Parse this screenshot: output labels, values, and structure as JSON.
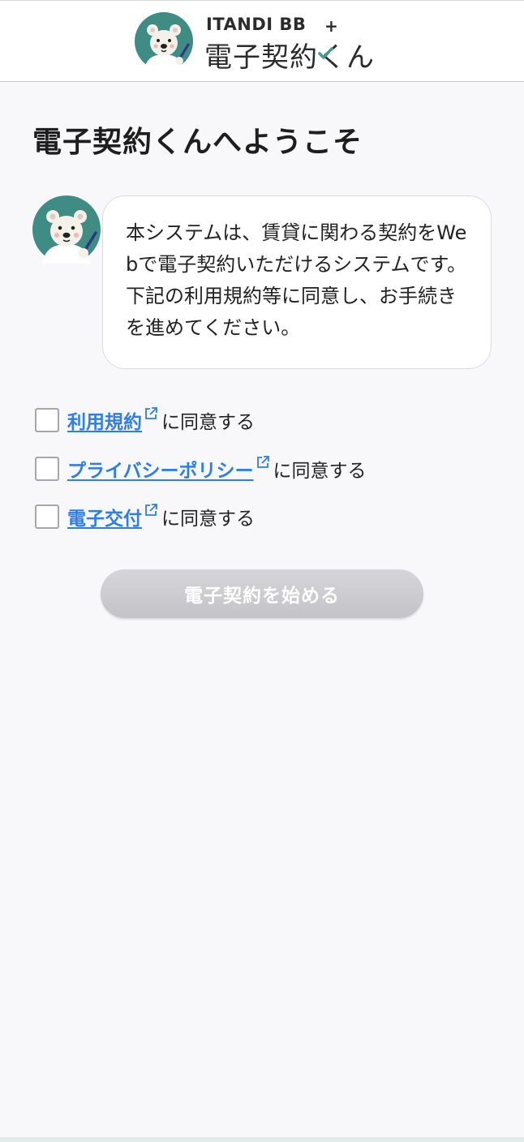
{
  "header": {
    "brand_top": "ITANDI BB",
    "brand_plus": "+",
    "brand_main": "電子契約くん"
  },
  "page": {
    "title": "電子契約くんへようこそ"
  },
  "message": {
    "text": "本システムは、賃貸に関わる契約をWebで電子契約いただけるシステムです。下記の利用規約等に同意し、お手続きを進めてください。"
  },
  "agreements": [
    {
      "link": "利用規約",
      "suffix": "に同意する",
      "checked": false
    },
    {
      "link": "プライバシーポリシー",
      "suffix": "に同意する",
      "checked": false
    },
    {
      "link": "電子交付",
      "suffix": "に同意する",
      "checked": false
    }
  ],
  "start_button": {
    "label": "電子契約を始める",
    "disabled": true
  },
  "colors": {
    "link": "#2f7ee6",
    "avatar_bg": "#3f8c85",
    "button_disabled": "#c9c9cd",
    "page_bg": "#f8f8fa"
  },
  "icons": {
    "avatar": "polar-bear-icon",
    "external_link": "external-link-icon",
    "check": "check-icon"
  }
}
